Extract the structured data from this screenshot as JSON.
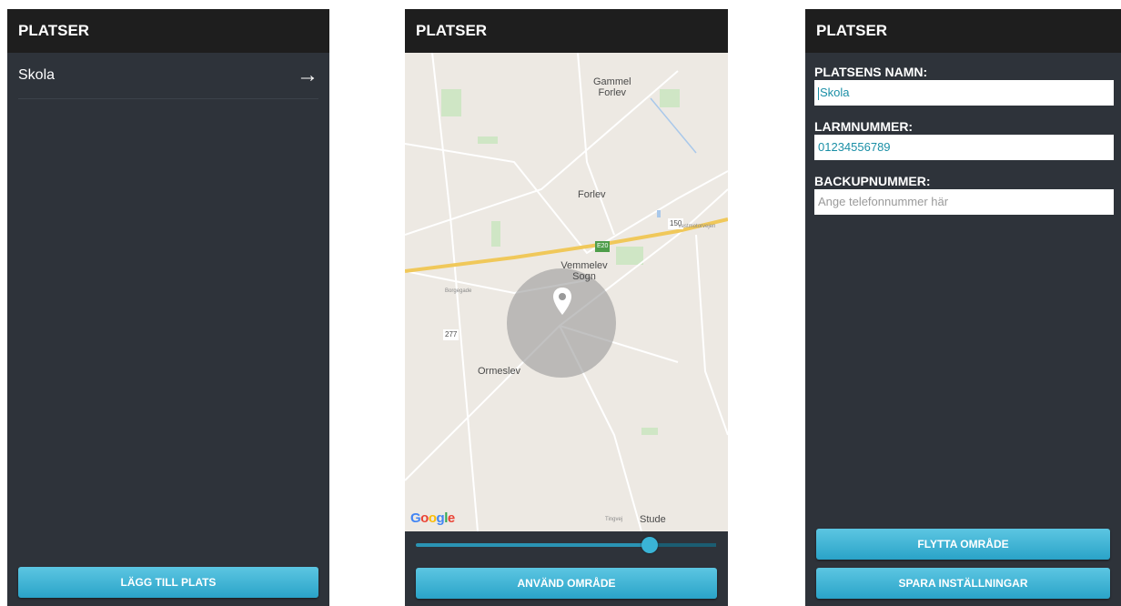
{
  "screen1": {
    "title": "PLATSER",
    "items": [
      {
        "label": "Skola",
        "icon": "arrow-right-icon"
      }
    ],
    "add_button": "LÄGG TILL PLATS"
  },
  "screen2": {
    "title": "PLATSER",
    "map": {
      "places": [
        "Gammel Forlev",
        "Forlev",
        "Vemmelev Sogn",
        "Ormeslev",
        "Stude"
      ],
      "road_numbers": [
        "150",
        "E20",
        "277"
      ],
      "road_names": [
        "Vestmotorvejen",
        "Borgegade",
        "Tingvej"
      ],
      "attribution": "Google",
      "marker_icon": "map-pin-icon"
    },
    "radius_slider_value": 0.78,
    "use_button": "ANVÄND OMRÅDE"
  },
  "screen3": {
    "title": "PLATSER",
    "name_label": "PLATSENS NAMN:",
    "name_value": "Skola",
    "alarm_label": "LARMNUMMER:",
    "alarm_value": "01234556789",
    "backup_label": "BACKUPNUMMER:",
    "backup_placeholder": "Ange telefonnummer här",
    "move_button": "FLYTTA OMRÅDE",
    "save_button": "SPARA INSTÄLLNINGAR"
  },
  "colors": {
    "accent": "#2aa3c8",
    "background": "#2e333a",
    "appbar": "#1e1e1e"
  }
}
